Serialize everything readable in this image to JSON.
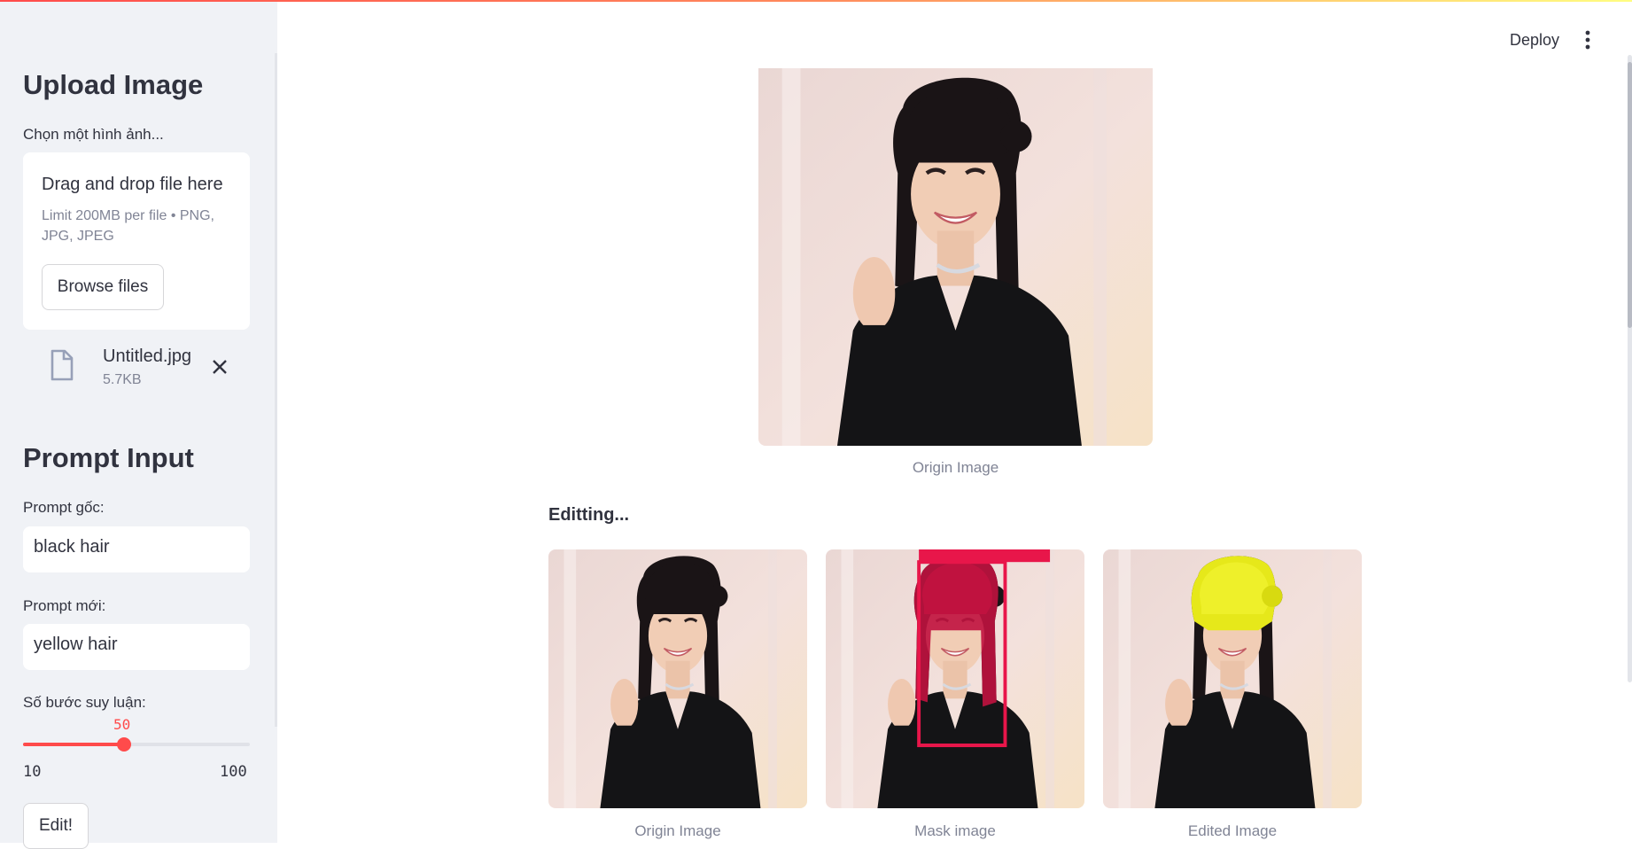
{
  "sidebar": {
    "upload_heading": "Upload Image",
    "file_label": "Chọn một hình ảnh...",
    "dropzone_title": "Drag and drop file here",
    "dropzone_limit": "Limit 200MB per file • PNG, JPG, JPEG",
    "browse_label": "Browse files",
    "file": {
      "name": "Untitled.jpg",
      "size": "5.7KB",
      "icon": "file-icon"
    },
    "prompt_heading": "Prompt Input",
    "prompt_orig_label": "Prompt gốc:",
    "prompt_orig_value": "black hair",
    "prompt_new_label": "Prompt mới:",
    "prompt_new_value": "yellow hair",
    "steps_label": "Số bước suy luận:",
    "steps": {
      "value": "50",
      "min": "10",
      "max": "100",
      "fraction": 0.444
    },
    "edit_label": "Edit!"
  },
  "header": {
    "deploy_label": "Deploy",
    "menu_icon": "kebab-menu-icon"
  },
  "main": {
    "origin_caption": "Origin Image",
    "status": "Editting...",
    "results": [
      {
        "caption": "Origin Image"
      },
      {
        "caption": "Mask image"
      },
      {
        "caption": "Edited Image"
      }
    ]
  },
  "colors": {
    "accent": "#ff4b4b",
    "sidebar_bg": "#f0f2f6",
    "mask_color": "#e8164a",
    "edited_hair": "#e6e81a",
    "original_hair": "#1a1416"
  }
}
